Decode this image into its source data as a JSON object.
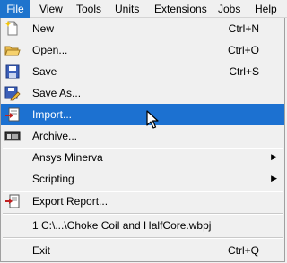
{
  "menubar": {
    "items": [
      {
        "label": "File"
      },
      {
        "label": "View"
      },
      {
        "label": "Tools"
      },
      {
        "label": "Units"
      },
      {
        "label": "Extensions"
      },
      {
        "label": "Jobs"
      },
      {
        "label": "Help"
      }
    ]
  },
  "file_menu": {
    "new": {
      "label": "New",
      "shortcut": "Ctrl+N",
      "icon": "new-file-icon"
    },
    "open": {
      "label": "Open...",
      "shortcut": "Ctrl+O",
      "icon": "open-folder-icon"
    },
    "save": {
      "label": "Save",
      "shortcut": "Ctrl+S",
      "icon": "save-icon"
    },
    "save_as": {
      "label": "Save As...",
      "icon": "save-as-icon"
    },
    "import": {
      "label": "Import...",
      "icon": "import-icon"
    },
    "archive": {
      "label": "Archive...",
      "icon": "archive-icon"
    },
    "ansys_minerva": {
      "label": "Ansys Minerva"
    },
    "scripting": {
      "label": "Scripting"
    },
    "export_report": {
      "label": "Export Report...",
      "icon": "export-report-icon"
    },
    "recent_file": {
      "label": "1 C:\\...\\Choke Coil and HalfCore.wbpj"
    },
    "exit": {
      "label": "Exit",
      "shortcut": "Ctrl+Q"
    }
  },
  "colors": {
    "menu_bg": "#f0f0f0",
    "highlight": "#1c71d1",
    "active_menubar": "#1e74cd"
  }
}
